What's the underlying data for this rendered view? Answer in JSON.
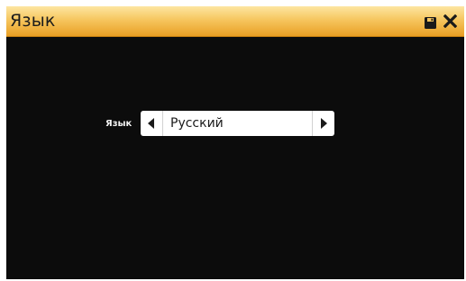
{
  "window": {
    "title": "Язык",
    "title_bar_colors": [
      "#fde6a2",
      "#e99f24"
    ],
    "background_color": "#0c0c0c"
  },
  "toolbar": {
    "save_icon": "floppy-disk-icon",
    "close_icon": "close-x-icon"
  },
  "language_setting": {
    "label": "Язык",
    "value": "Русский",
    "prev_icon": "triangle-left-icon",
    "next_icon": "triangle-right-icon"
  }
}
